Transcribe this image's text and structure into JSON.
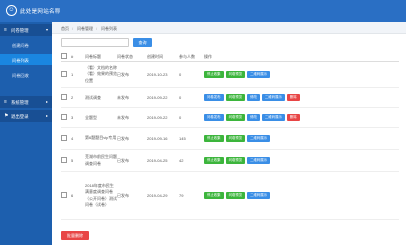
{
  "header": {
    "logo_glyph": "☺",
    "title": "此处是网站名称"
  },
  "sidebar": {
    "groups": [
      {
        "label": "问卷管理",
        "icon": "≡"
      },
      {
        "label": "系统管理",
        "icon": "≡"
      },
      {
        "label": "退出登录",
        "icon": "⚑"
      }
    ],
    "items": [
      {
        "label": "创建问卷"
      },
      {
        "label": "问卷列表"
      },
      {
        "label": "问卷回收"
      }
    ]
  },
  "breadcrumb": {
    "home": "首页",
    "sep1": "/",
    "section": "问卷管理",
    "sep2": "/",
    "page": "问卷列表"
  },
  "search": {
    "placeholder": "",
    "button_label": "查询"
  },
  "table": {
    "headers": [
      "",
      "#",
      "问卷标题",
      "问卷状态",
      "创建时间",
      "参与人数",
      "操作"
    ],
    "rows": [
      {
        "num": "1",
        "title": "（看）文档的名称（看）效果的预览位置",
        "status": "已发布",
        "date": "2019-10-23",
        "count": "0",
        "actions": [
          "停止收集",
          "问卷预览",
          "二维码展示"
        ]
      },
      {
        "num": "2",
        "title": "测试调查",
        "status": "未发布",
        "date": "2019-09-22",
        "count": "0",
        "actions": [
          "问卷发布",
          "问卷预览",
          "修改",
          "二维码展示",
          "删除"
        ]
      },
      {
        "num": "3",
        "title": "全题型",
        "status": "未发布",
        "date": "2019-09-22",
        "count": "0",
        "actions": [
          "问卷发布",
          "问卷预览",
          "修改",
          "二维码展示",
          "删除"
        ]
      },
      {
        "num": "4",
        "title": "第6题题目vip专用",
        "status": "已发布",
        "date": "2019-09-16",
        "count": "145",
        "actions": [
          "停止收集",
          "问卷预览",
          "二维码展示"
        ]
      },
      {
        "num": "5",
        "title": "芜湖市前民生问题调查问卷",
        "status": "已发布",
        "date": "2019-04-25",
        "count": "42",
        "actions": [
          "停止收集",
          "问卷预览",
          "二维码展示"
        ]
      },
      {
        "num": "6",
        "title": "2018年度市民生满意度调查问卷（公开问卷）测试问卷（试卷）",
        "status": "已发布",
        "date": "2019-04-29",
        "count": "79",
        "actions": [
          "停止收集",
          "问卷预览",
          "二维码展示"
        ]
      }
    ]
  },
  "bulk_delete_label": "批量删除",
  "colors": {
    "topbar": "#2a6fc4",
    "sidebar": "#1d5fae",
    "active": "#1a86e0",
    "green": "#3cb53c",
    "blue": "#3a8ee6",
    "red": "#e84545"
  }
}
